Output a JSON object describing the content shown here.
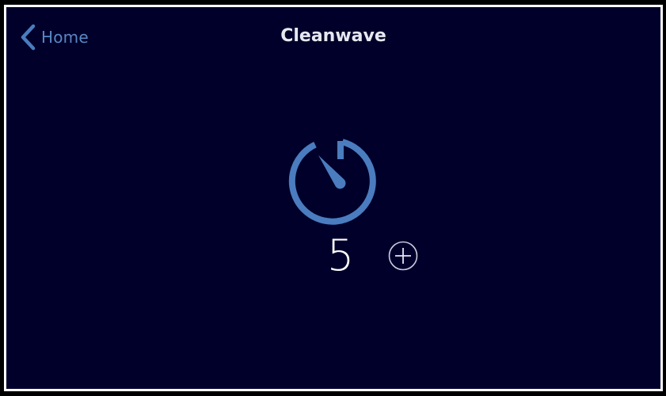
{
  "app": {
    "title": "Cleanwave"
  },
  "nav": {
    "back_label": "Home",
    "back_icon": "chevron-left-icon"
  },
  "timer": {
    "icon": "timer-icon",
    "value": "5",
    "increment_icon": "plus-circle-icon"
  },
  "colors": {
    "background": "#01002a",
    "accent": "#4a7cbf",
    "text": "#ffffff",
    "border": "#ffffff"
  }
}
